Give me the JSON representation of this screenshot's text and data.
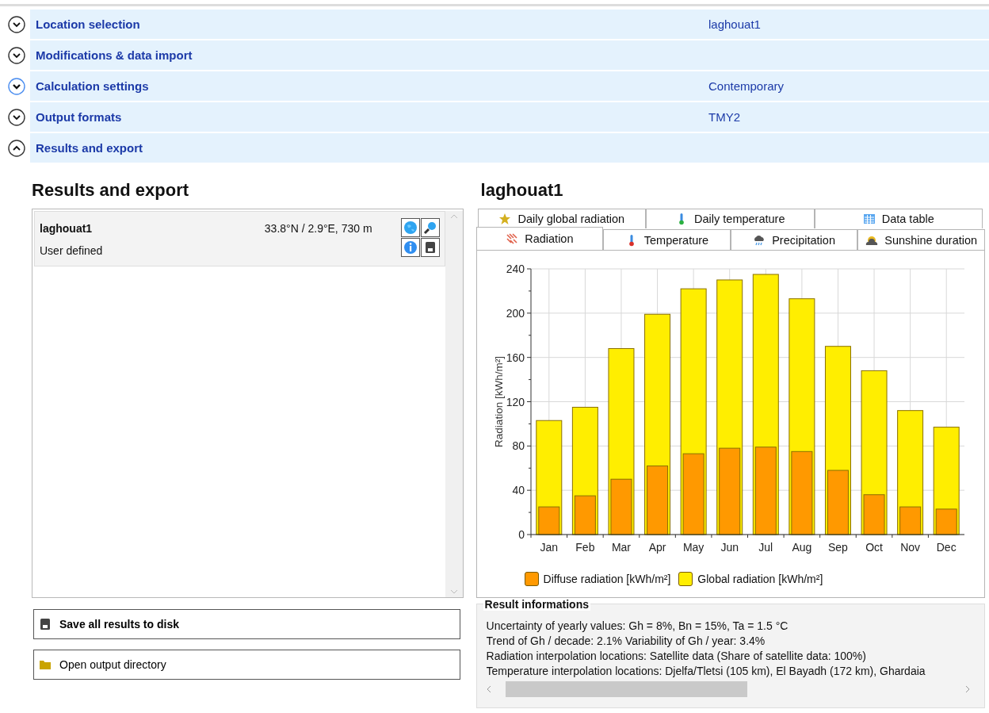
{
  "sections": [
    {
      "label": "Location selection",
      "value": "laghouat1",
      "expanded": false,
      "highlighted": false
    },
    {
      "label": "Modifications & data import",
      "expanded": false,
      "highlighted": false
    },
    {
      "label": "Calculation settings",
      "value": "Contemporary",
      "expanded": false,
      "highlighted": true
    },
    {
      "label": "Output formats",
      "value": "TMY2",
      "expanded": false,
      "highlighted": false
    },
    {
      "label": "Results and export",
      "expanded": true,
      "highlighted": false
    }
  ],
  "results": {
    "title": "Results and export",
    "locations": [
      {
        "name": "laghouat1",
        "coordinates": "33.8°N / 2.9°E, 730 m",
        "source": "User defined",
        "selected": true
      }
    ],
    "buttons": [
      {
        "label": "Save all results to disk",
        "kind": "save"
      },
      {
        "label": "Open output directory",
        "kind": "folder"
      }
    ]
  },
  "detail": {
    "title": "laghouat1",
    "tab_rows": [
      [
        {
          "label": "Daily global radiation",
          "selected": false
        },
        {
          "label": "Daily temperature",
          "selected": false
        },
        {
          "label": "Data table",
          "selected": false
        }
      ],
      [
        {
          "label": "Radiation",
          "selected": true
        },
        {
          "label": "Temperature",
          "selected": false
        },
        {
          "label": "Precipitation",
          "selected": false
        },
        {
          "label": "Sunshine duration",
          "selected": false
        }
      ]
    ],
    "chart_data": {
      "type": "bar",
      "ylabel": "Radiation [kWh/m²]",
      "categories": [
        "Jan",
        "Feb",
        "Mar",
        "Apr",
        "May",
        "Jun",
        "Jul",
        "Aug",
        "Sep",
        "Oct",
        "Nov",
        "Dec"
      ],
      "series": [
        {
          "name": "Diffuse radiation [kWh/m²]",
          "color": "#ff9900",
          "values": [
            25,
            35,
            50,
            62,
            73,
            78,
            79,
            75,
            58,
            36,
            25,
            23
          ]
        },
        {
          "name": "Global radiation [kWh/m²]",
          "color": "#ffee00",
          "values": [
            103,
            115,
            168,
            199,
            222,
            230,
            235,
            213,
            170,
            148,
            112,
            97
          ]
        }
      ],
      "ylim": [
        0,
        240
      ],
      "yticks": [
        0,
        40,
        80,
        120,
        160,
        200,
        240
      ],
      "stacked": false,
      "grid": true,
      "legend": true
    },
    "info": {
      "title": "Result informations",
      "lines": [
        "Uncertainty of yearly values: Gh = 8%, Bn = 15%, Ta = 1.5 °C",
        "Trend of Gh / decade: 2.1%   Variability of Gh / year: 3.4%",
        "Radiation interpolation locations: Satellite data  (Share of satellite data: 100%)",
        "Temperature interpolation locations: Djelfa/Tletsi (105 km), El Bayadh (172 km), Ghardaia"
      ]
    }
  }
}
